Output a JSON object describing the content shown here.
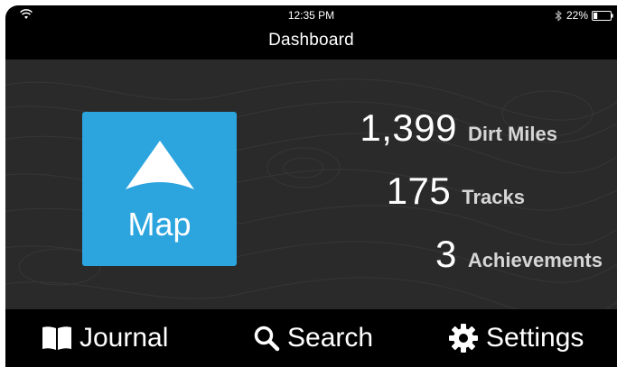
{
  "status_bar": {
    "time": "12:35 PM",
    "battery": "22%",
    "icons": [
      "wifi-icon",
      "bluetooth-icon",
      "battery-icon"
    ]
  },
  "nav": {
    "title": "Dashboard"
  },
  "map_tile": {
    "label": "Map",
    "icon": "navigation-arrow-icon",
    "color": "#2ca5df"
  },
  "stats": [
    {
      "value": "1,399",
      "label": "Dirt Miles"
    },
    {
      "value": "175",
      "label": "Tracks"
    },
    {
      "value": "3",
      "label": "Achievements"
    }
  ],
  "tab_bar": {
    "items": [
      {
        "label": "Journal",
        "icon": "book-icon"
      },
      {
        "label": "Search",
        "icon": "search-icon"
      },
      {
        "label": "Settings",
        "icon": "gear-icon"
      }
    ]
  },
  "colors": {
    "background": "#000000",
    "content_background": "#2a2a2a",
    "accent": "#2ca5df",
    "text": "#ffffff",
    "secondary_text": "#d6d6d6"
  }
}
